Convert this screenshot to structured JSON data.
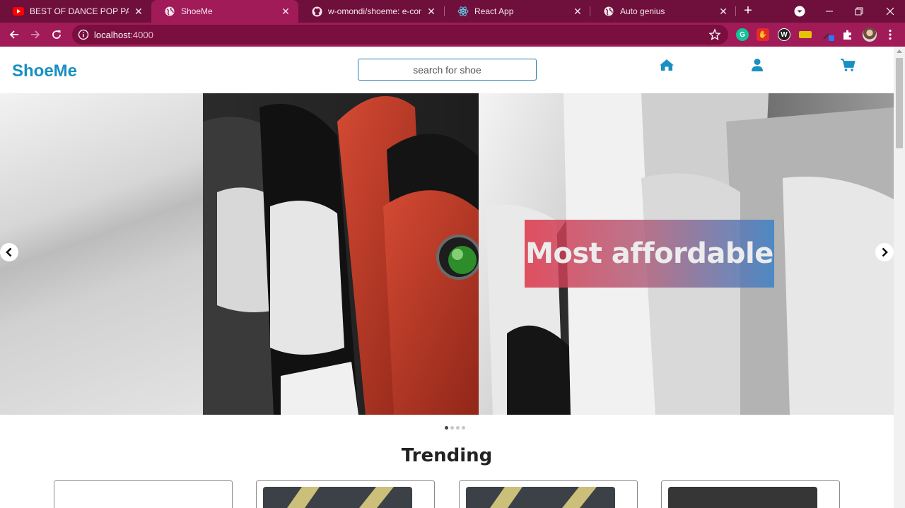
{
  "browser": {
    "tabs": [
      {
        "title": "BEST OF DANCE POP PARTY M",
        "icon": "youtube-icon",
        "active": false
      },
      {
        "title": "ShoeMe",
        "icon": "globe-icon",
        "active": true
      },
      {
        "title": "w-omondi/shoeme: e-comme",
        "icon": "github-icon",
        "active": false
      },
      {
        "title": "React App",
        "icon": "react-icon",
        "active": false
      },
      {
        "title": "Auto genius",
        "icon": "globe-icon",
        "active": false
      }
    ],
    "address": {
      "host": "localhost",
      "port": ":4000"
    }
  },
  "site": {
    "logo": "ShoeMe",
    "search_placeholder": "search for shoe",
    "nav_icons": [
      "home-icon",
      "user-icon",
      "cart-icon"
    ],
    "accent_color": "#1a8fc1"
  },
  "carousel": {
    "caption": "Most affordable",
    "slide_count": 4,
    "active_slide": 1
  },
  "trending": {
    "title": "Trending",
    "cards": 4
  },
  "colors": {
    "tab_strip": "#6f0f3b",
    "toolbar": "#a01b58"
  }
}
